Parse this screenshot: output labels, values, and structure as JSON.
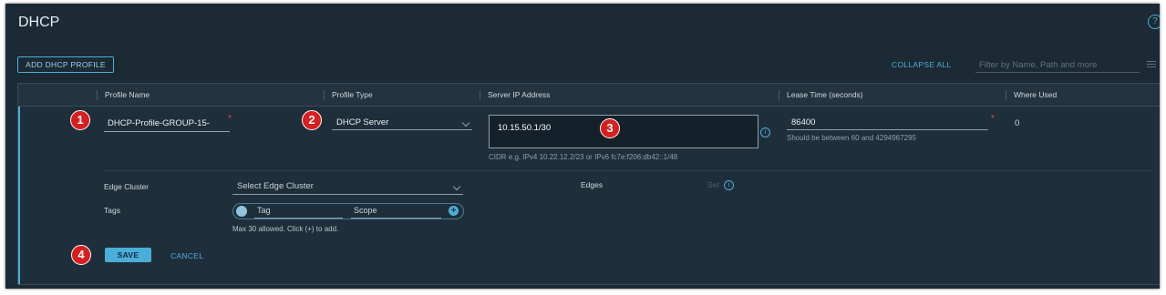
{
  "page": {
    "title": "DHCP",
    "help_icon": "question-circle-icon",
    "add_button": "ADD DHCP PROFILE",
    "collapse_all": "COLLAPSE ALL",
    "filter_placeholder": "Filter by Name, Path and more"
  },
  "table": {
    "columns": [
      "Profile Name",
      "Profile Type",
      "Server IP Address",
      "Lease Time (seconds)",
      "Where Used"
    ]
  },
  "row": {
    "profile_name": "DHCP-Profile-GROUP-15-",
    "profile_type": "DHCP Server",
    "server_ip": "10.15.50.1/30",
    "server_ip_hint": "CIDR e.g. IPv4 10.22.12.2/23 or IPv6 fc7e:f206:db42::1/48",
    "lease_time": "86400",
    "lease_hint": "Should be between 60 and 4294967295",
    "where_used": "0",
    "required_mark": "*",
    "edge_cluster_label": "Edge Cluster",
    "edge_cluster_placeholder": "Select Edge Cluster",
    "edges_label": "Edges",
    "edges_set": "Set",
    "tags_label": "Tags",
    "tag_placeholder": "Tag",
    "scope_placeholder": "Scope",
    "tags_hint": "Max 30 allowed. Click (+) to add.",
    "save": "SAVE",
    "cancel": "CANCEL"
  },
  "badges": [
    "1",
    "2",
    "3",
    "4"
  ],
  "colors": {
    "background": "#1b2a35",
    "accent": "#49afd9",
    "badge": "#d81e1e"
  }
}
